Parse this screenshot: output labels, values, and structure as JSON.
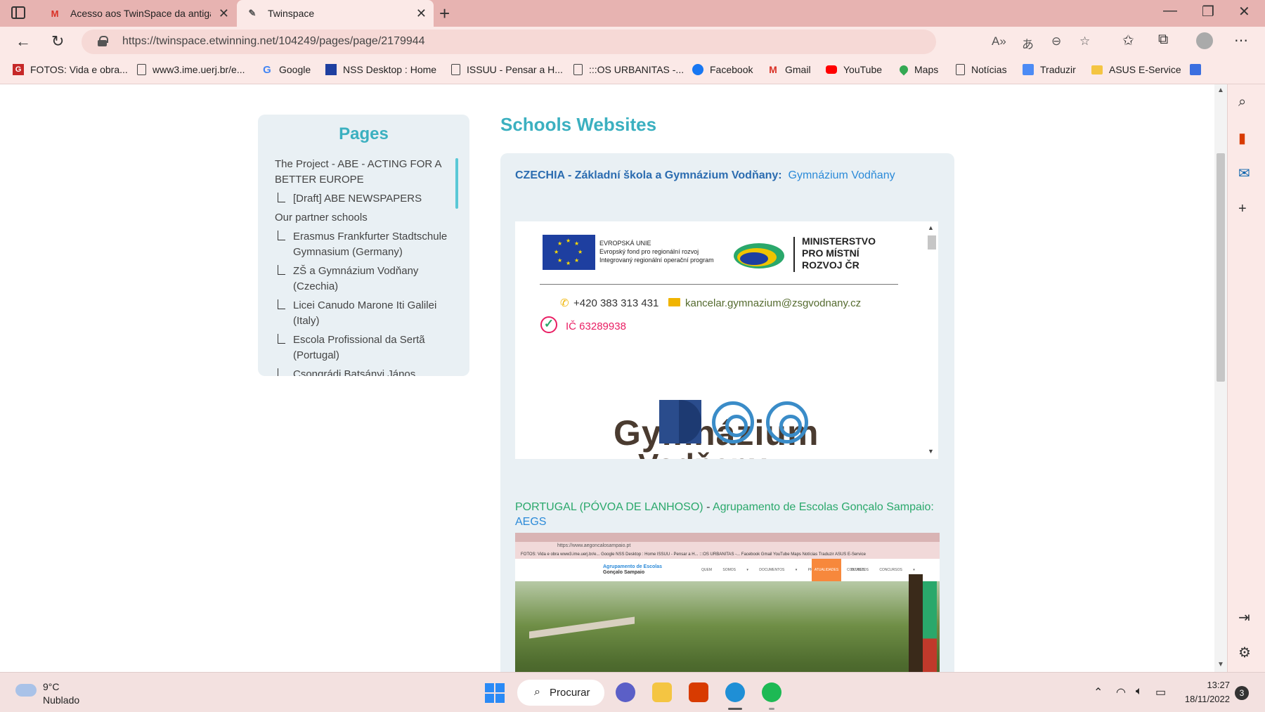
{
  "browser": {
    "tabs": [
      {
        "title": "Acesso aos TwinSpace da antiga",
        "favicon": "gmail-icon",
        "active": false
      },
      {
        "title": "Twinspace",
        "favicon": "twinspace-icon",
        "active": true
      }
    ],
    "url": "https://twinspace.etwinning.net/104249/pages/page/2179944",
    "favorites": [
      {
        "label": "FOTOS: Vida e obra...",
        "icon": "fotos-icon"
      },
      {
        "label": "www3.ime.uerj.br/e...",
        "icon": "page-icon"
      },
      {
        "label": "Google",
        "icon": "google-icon"
      },
      {
        "label": "NSS Desktop : Home",
        "icon": "eu-flag-icon"
      },
      {
        "label": "ISSUU - Pensar a H...",
        "icon": "page-icon"
      },
      {
        "label": ":::OS URBANITAS -...",
        "icon": "page-icon"
      },
      {
        "label": "Facebook",
        "icon": "facebook-icon"
      },
      {
        "label": "Gmail",
        "icon": "gmail-icon"
      },
      {
        "label": "YouTube",
        "icon": "youtube-icon"
      },
      {
        "label": "Maps",
        "icon": "maps-icon"
      },
      {
        "label": "Notícias",
        "icon": "page-icon"
      },
      {
        "label": "Traduzir",
        "icon": "translate-icon"
      },
      {
        "label": "ASUS E-Service",
        "icon": "folder-icon"
      }
    ]
  },
  "sidebar": {
    "title": "Pages",
    "items": [
      {
        "label": "The Project - ABE - ACTING FOR A BETTER EUROPE",
        "level": 0
      },
      {
        "label": "[Draft] ABE NEWSPAPERS",
        "level": 1
      },
      {
        "label": "Our partner schools",
        "level": 0
      },
      {
        "label": "Erasmus Frankfurter Stadtschule Gymnasium (Germany)",
        "level": 1
      },
      {
        "label": "ZŠ a Gymnázium Vodňany (Czechia)",
        "level": 1
      },
      {
        "label": "Licei Canudo Marone Iti Galilei (Italy)",
        "level": 1
      },
      {
        "label": "Escola Profissional da Sertã (Portugal)",
        "level": 1
      },
      {
        "label": "Csongrádi Batsányi János Gimnázium (Hungary)",
        "level": 1
      }
    ]
  },
  "main": {
    "title": "Schools Websites",
    "czech": {
      "prefix": "CZECHIA - Základní škola a Gymnázium Vodňany:",
      "link": "Gymnázium Vodňany",
      "embed": {
        "eu_title": "EVROPSKÁ UNIE",
        "eu_line1": "Evropský fond pro regionální rozvoj",
        "eu_line2": "Integrovaný regionální operační program",
        "ministry_line1": "MINISTERSTVO",
        "ministry_line2": "PRO MÍSTNÍ",
        "ministry_line3": "ROZVOJ ČR",
        "phone": "+420 383 313 431",
        "email": "kancelar.gymnazium@zsgvodnany.cz",
        "ic": "IČ 63289938",
        "big_text": "Gymnázium",
        "big_text2": "Vodňany"
      }
    },
    "portugal": {
      "prefix": "PORTUGAL (PÓVOA DE LANHOSO)",
      "separator": " - ",
      "school": "Agrupamento de Escolas Gonçalo Sampaio:",
      "link": "AEGS",
      "screenshot": {
        "url": "https://www.aegoncalosampaio.pt",
        "favs": "FOTOS: Vida e obra   www3.ime.uerj.br/e...   Google   NSS Desktop : Home   ISSUU - Pensar a H...   :::OS URBANITAS -...   Facebook   Gmail   YouTube   Maps   Notícias   Traduzir   ASUS E-Service",
        "site_name": "Agrupamento de Escolas",
        "site_name2": "Gonçalo Sampaio",
        "menu": "QUEM SOMOS ▾ DOCUMENTOS ▾ PROJETOS E CLUBES",
        "menu_active": "ATUALIDADES",
        "menu_rest": "CONTACTOS CONCURSOS ▾"
      }
    }
  },
  "taskbar": {
    "weather_temp": "9°C",
    "weather_desc": "Nublado",
    "search_label": "Procurar",
    "time": "13:27",
    "date": "18/11/2022",
    "notifications": "3"
  }
}
